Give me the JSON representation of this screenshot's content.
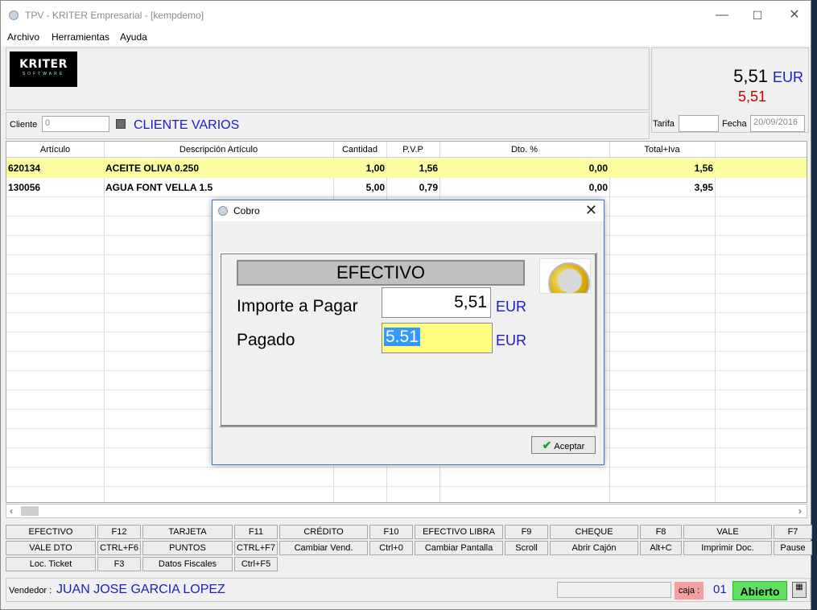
{
  "window": {
    "title": "TPV - KRITER Empresarial -  [kempdemo]",
    "minimize": "—",
    "maximize": "☐",
    "close": "✕"
  },
  "menu": [
    "Archivo",
    "Herramientas",
    "Ayuda"
  ],
  "logo": {
    "line1": "KRITER",
    "line2": "SOFTWARE"
  },
  "totals": {
    "amount": "5,51",
    "currency": "EUR",
    "secondary": "5,51"
  },
  "client": {
    "label": "Cliente",
    "code": "0",
    "name": "CLIENTE VARIOS",
    "tarifa_label": "Tarifa",
    "tarifa": "",
    "fecha_label": "Fecha",
    "fecha": "20/09/2016"
  },
  "grid": {
    "headers": [
      "Artículo",
      "Descripción Artículo",
      "Cantidad",
      "P.V.P",
      "Dto. %",
      "Total+Iva"
    ],
    "rows": [
      {
        "articulo": "620134",
        "descripcion": "ACEITE OLIVA 0.250",
        "cantidad": "1,00",
        "pvp": "1,56",
        "dto": "0,00",
        "total": "1,56"
      },
      {
        "articulo": "130056",
        "descripcion": "AGUA FONT VELLA 1.5",
        "cantidad": "5,00",
        "pvp": "0,79",
        "dto": "0,00",
        "total": "3,95"
      }
    ]
  },
  "fkeys": {
    "row1": [
      {
        "label": "EFECTIVO",
        "key": "F12"
      },
      {
        "label": "TARJETA",
        "key": "F11"
      },
      {
        "label": "CRÉDITO",
        "key": "F10"
      },
      {
        "label": "EFECTIVO LIBRA",
        "key": "F9"
      },
      {
        "label": "CHEQUE",
        "key": "F8"
      },
      {
        "label": "VALE",
        "key": "F7"
      }
    ],
    "row2": [
      {
        "label": "VALE DTO",
        "key": "CTRL+F6"
      },
      {
        "label": "PUNTOS",
        "key": "CTRL+F7"
      },
      {
        "label": "Cambiar Vend.",
        "key": "Ctrl+0"
      },
      {
        "label": "Cambiar Pantalla",
        "key": "Scroll"
      },
      {
        "label": "Abrir Cajón",
        "key": "Alt+C"
      },
      {
        "label": "Imprimir Doc.",
        "key": "Pause"
      }
    ],
    "row3": [
      {
        "label": "Loc. Ticket",
        "key": "F3"
      },
      {
        "label": "Datos Fiscales",
        "key": "Ctrl+F5"
      }
    ]
  },
  "status": {
    "vendedor_label": "Vendedor :",
    "vendedor": "JUAN JOSE GARCIA LOPEZ",
    "caja_label": "caja :",
    "caja": "01",
    "estado": "Abierto"
  },
  "dialog": {
    "title": "Cobro",
    "close": "✕",
    "method": "EFECTIVO",
    "importe_label": "Importe a Pagar",
    "importe": "5,51",
    "importe_currency": "EUR",
    "pagado_label": "Pagado",
    "pagado": "5.51",
    "pagado_currency": "EUR",
    "accept": "Aceptar",
    "accept_check": "✔"
  },
  "icons": [
    "app-icon",
    "checkbox-icon",
    "euro-coin-icon",
    "calculator-icon",
    "scroll-left-icon",
    "scroll-right-icon"
  ]
}
